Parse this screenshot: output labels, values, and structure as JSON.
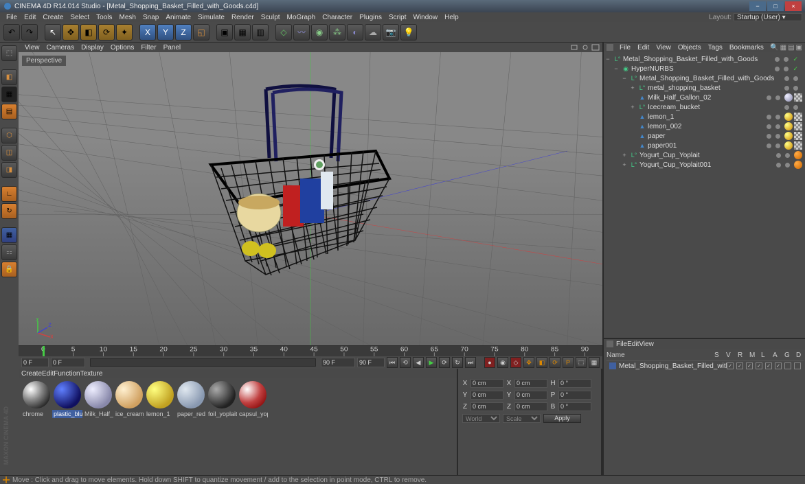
{
  "titlebar": {
    "text": "CINEMA 4D R14.014 Studio - [Metal_Shopping_Basket_Filled_with_Goods.c4d]"
  },
  "menubar": {
    "items": [
      "File",
      "Edit",
      "Create",
      "Select",
      "Tools",
      "Mesh",
      "Snap",
      "Animate",
      "Simulate",
      "Render",
      "Sculpt",
      "MoGraph",
      "Character",
      "Plugins",
      "Script",
      "Window",
      "Help"
    ],
    "layout_label": "Layout:",
    "layout_value": "Startup (User)"
  },
  "viewport_menu": {
    "items": [
      "View",
      "Cameras",
      "Display",
      "Options",
      "Filter",
      "Panel"
    ]
  },
  "viewport": {
    "label": "Perspective"
  },
  "object_panel": {
    "menu": [
      "File",
      "Edit",
      "View",
      "Objects",
      "Tags",
      "Bookmarks"
    ],
    "tree": [
      {
        "indent": 0,
        "exp": "−",
        "icon": "null-green",
        "label": "Metal_Shopping_Basket_Filled_with_Goods"
      },
      {
        "indent": 1,
        "exp": "−",
        "icon": "hypernurbs",
        "label": "HyperNURBS"
      },
      {
        "indent": 2,
        "exp": "−",
        "icon": "null-green",
        "label": "Metal_Shopping_Basket_Filled_with_Goods"
      },
      {
        "indent": 3,
        "exp": "+",
        "icon": "null-green",
        "label": "metal_shopping_basket"
      },
      {
        "indent": 3,
        "exp": "",
        "icon": "poly",
        "label": "Milk_Half_Gallon_02",
        "tags": [
          "grad-blue",
          "check"
        ]
      },
      {
        "indent": 3,
        "exp": "+",
        "icon": "null-green",
        "label": "Icecream_bucket"
      },
      {
        "indent": 3,
        "exp": "",
        "icon": "poly",
        "label": "lemon_1",
        "tags": [
          "yellow",
          "check"
        ]
      },
      {
        "indent": 3,
        "exp": "",
        "icon": "poly",
        "label": "lemon_002",
        "tags": [
          "yellow",
          "check"
        ]
      },
      {
        "indent": 3,
        "exp": "",
        "icon": "poly",
        "label": "paper",
        "tags": [
          "yellow",
          "check"
        ]
      },
      {
        "indent": 3,
        "exp": "",
        "icon": "poly",
        "label": "paper001",
        "tags": [
          "yellow",
          "check"
        ]
      },
      {
        "indent": 2,
        "exp": "+",
        "icon": "null-green",
        "label": "Yogurt_Cup_Yoplait",
        "tags": [
          "orange"
        ]
      },
      {
        "indent": 2,
        "exp": "+",
        "icon": "null-green",
        "label": "Yogurt_Cup_Yoplait001",
        "tags": [
          "orange"
        ]
      }
    ]
  },
  "timeline": {
    "ticks": [
      0,
      5,
      10,
      15,
      20,
      25,
      30,
      35,
      40,
      45,
      50,
      55,
      60,
      65,
      70,
      75,
      80,
      85,
      90
    ],
    "start": "0 F",
    "range_start": "0 F",
    "range_end": "90 F",
    "end": "90 F"
  },
  "materials": {
    "menu": [
      "Create",
      "Edit",
      "Function",
      "Texture"
    ],
    "items": [
      {
        "name": "chrome",
        "color": "radial-gradient(circle at 30% 30%, #fff, #888 40%, #222 80%)"
      },
      {
        "name": "plastic_blu",
        "color": "radial-gradient(circle at 30% 30%, #6080ff, #101060 70%)",
        "selected": true
      },
      {
        "name": "Milk_Half_",
        "color": "radial-gradient(circle at 30% 30%, #eef, #88a 70%)"
      },
      {
        "name": "ice_cream_",
        "color": "radial-gradient(circle at 30% 30%, #fff0d0, #d0a060 70%)"
      },
      {
        "name": "lemon_1",
        "color": "radial-gradient(circle at 30% 30%, #ffff80, #c0a020 70%)"
      },
      {
        "name": "paper_red",
        "color": "radial-gradient(circle at 30% 30%, #e0e8f0, #8898b0 70%)"
      },
      {
        "name": "foil_yoplait",
        "color": "radial-gradient(circle at 30% 30%, #aaa, #222 70%)"
      },
      {
        "name": "capsul_yop",
        "color": "radial-gradient(circle at 30% 30%, #fff, #c04040 50%, #901010 80%)"
      }
    ]
  },
  "coords": {
    "x": {
      "pos": "0 cm",
      "size": "0 cm",
      "rot": "0 °",
      "pos_label": "X",
      "size_label": "X",
      "rot_label": "H"
    },
    "y": {
      "pos": "0 cm",
      "size": "0 cm",
      "rot": "0 °",
      "pos_label": "Y",
      "size_label": "Y",
      "rot_label": "P"
    },
    "z": {
      "pos": "0 cm",
      "size": "0 cm",
      "rot": "0 °",
      "pos_label": "Z",
      "size_label": "Z",
      "rot_label": "B"
    },
    "mode1": "World",
    "mode2": "Scale",
    "apply": "Apply"
  },
  "attributes": {
    "menu": [
      "File",
      "Edit",
      "View"
    ],
    "name_header": "Name",
    "columns": [
      "S",
      "V",
      "R",
      "M",
      "L",
      "A",
      "G",
      "D"
    ],
    "item": "Metal_Shopping_Basket_Filled_with_Goods"
  },
  "statusbar": {
    "text": "Move : Click and drag to move elements. Hold down SHIFT to quantize movement / add to the selection in point mode, CTRL to remove."
  },
  "maxon": "MAXON CINEMA 4D"
}
